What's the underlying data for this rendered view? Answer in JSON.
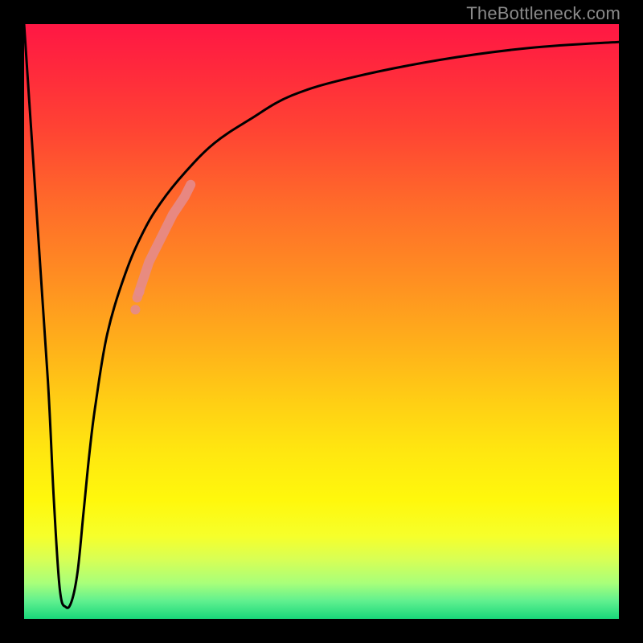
{
  "watermark": {
    "text": "TheBottleneck.com"
  },
  "chart_data": {
    "type": "line",
    "title": "",
    "xlabel": "",
    "ylabel": "",
    "xlim": [
      0,
      100
    ],
    "ylim": [
      0,
      100
    ],
    "grid": false,
    "legend": false,
    "background_gradient_stops": [
      {
        "pos": 0,
        "color": "#ff1744"
      },
      {
        "pos": 18,
        "color": "#ff4433"
      },
      {
        "pos": 42,
        "color": "#ff8c22"
      },
      {
        "pos": 72,
        "color": "#ffe710"
      },
      {
        "pos": 90,
        "color": "#d8ff55"
      },
      {
        "pos": 100,
        "color": "#18d77a"
      }
    ],
    "series": [
      {
        "name": "bottleneck-curve",
        "x": [
          0,
          2,
          4,
          5,
          6,
          7,
          8,
          9,
          10,
          11,
          12,
          14,
          17,
          20,
          23,
          27,
          32,
          38,
          45,
          55,
          70,
          85,
          100
        ],
        "y": [
          100,
          70,
          40,
          20,
          5,
          2,
          3,
          8,
          18,
          28,
          36,
          48,
          58,
          65,
          70,
          75,
          80,
          84,
          88,
          91,
          94,
          96,
          97
        ]
      }
    ],
    "highlight_segment": {
      "name": "salmon-marker-band",
      "x": [
        19,
        20,
        21,
        22,
        23,
        24,
        25,
        27,
        28
      ],
      "y": [
        54,
        57,
        60,
        62,
        64,
        66,
        68,
        71,
        73
      ]
    },
    "annotations": []
  }
}
